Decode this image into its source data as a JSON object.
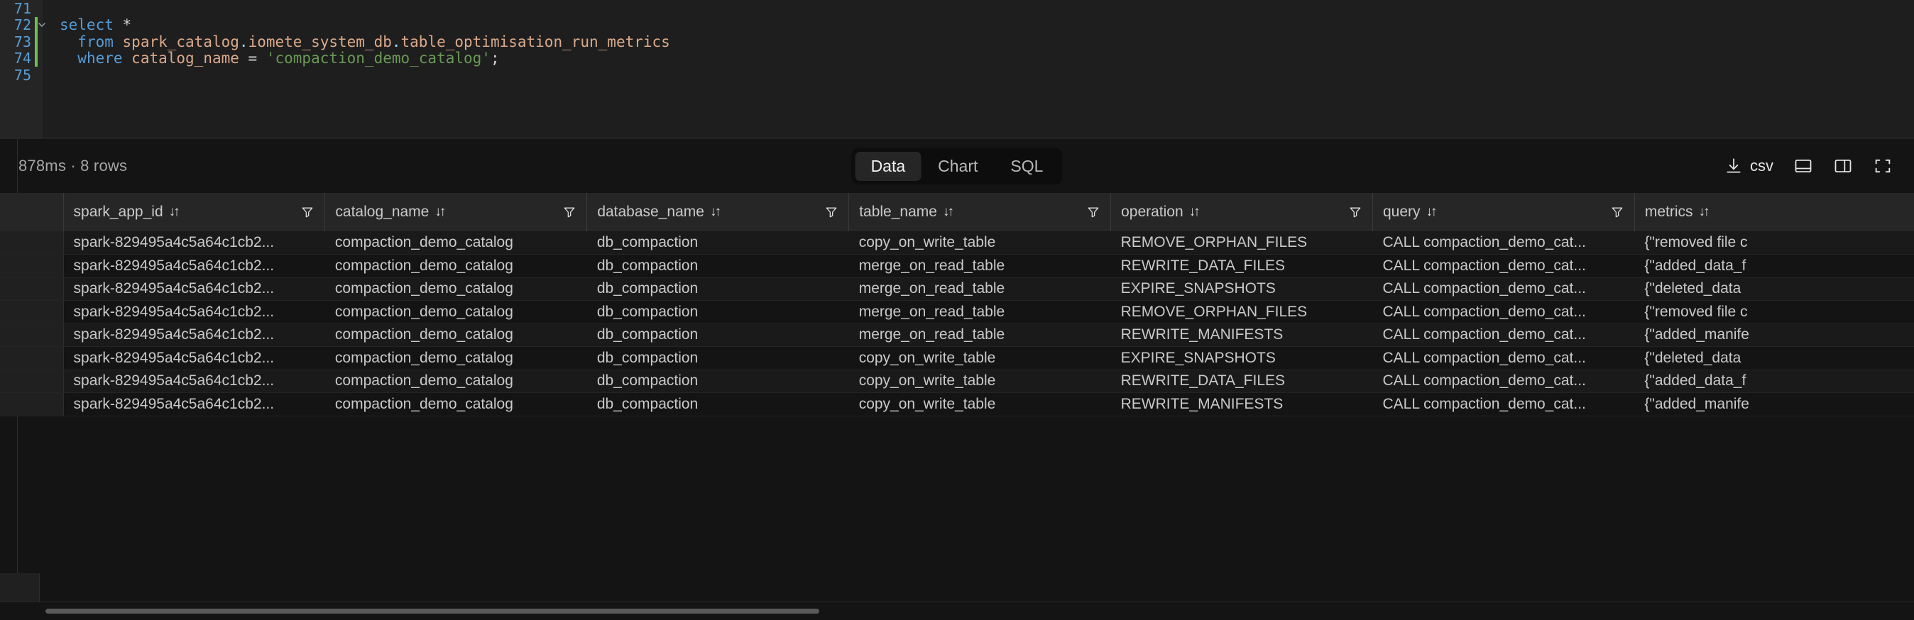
{
  "editor": {
    "lines": [
      {
        "number": "71",
        "active": false,
        "fold": "",
        "tokens": []
      },
      {
        "number": "72",
        "active": true,
        "fold": "chevron-down",
        "tokens": [
          {
            "t": "select",
            "c": "kw"
          },
          {
            "t": " ",
            "c": "op"
          },
          {
            "t": "*",
            "c": "star"
          }
        ]
      },
      {
        "number": "73",
        "active": true,
        "fold": "",
        "tokens": [
          {
            "t": "  ",
            "c": "op"
          },
          {
            "t": "from",
            "c": "kw"
          },
          {
            "t": " ",
            "c": "op"
          },
          {
            "t": "spark_catalog",
            "c": "ident"
          },
          {
            "t": ".",
            "c": "punct"
          },
          {
            "t": "iomete_system_db",
            "c": "ident"
          },
          {
            "t": ".",
            "c": "punct"
          },
          {
            "t": "table_optimisation_run_metrics",
            "c": "ident"
          }
        ]
      },
      {
        "number": "74",
        "active": true,
        "fold": "",
        "tokens": [
          {
            "t": "  ",
            "c": "op"
          },
          {
            "t": "where",
            "c": "kw"
          },
          {
            "t": " ",
            "c": "op"
          },
          {
            "t": "catalog_name",
            "c": "ident"
          },
          {
            "t": " ",
            "c": "op"
          },
          {
            "t": "=",
            "c": "op"
          },
          {
            "t": " ",
            "c": "op"
          },
          {
            "t": "'compaction_demo_catalog'",
            "c": "str"
          },
          {
            "t": ";",
            "c": "op"
          }
        ]
      },
      {
        "number": "75",
        "active": false,
        "fold": "",
        "tokens": []
      }
    ]
  },
  "results": {
    "status": "878ms · 8 rows",
    "tabs": [
      {
        "label": "Data",
        "active": true
      },
      {
        "label": "Chart",
        "active": false
      },
      {
        "label": "SQL",
        "active": false
      }
    ],
    "tools": [
      {
        "name": "download-csv",
        "label": "csv",
        "icon": "download-icon"
      },
      {
        "name": "split-horizontal",
        "label": "",
        "icon": "layout-horizontal-icon"
      },
      {
        "name": "split-vertical",
        "label": "",
        "icon": "layout-vertical-icon"
      },
      {
        "name": "fullscreen",
        "label": "",
        "icon": "fullscreen-icon"
      }
    ],
    "table": {
      "columns": [
        {
          "key": "spark_app_id",
          "label": "spark_app_id",
          "sortable": true,
          "filterable": true
        },
        {
          "key": "catalog_name",
          "label": "catalog_name",
          "sortable": true,
          "filterable": true
        },
        {
          "key": "database_name",
          "label": "database_name",
          "sortable": true,
          "filterable": true
        },
        {
          "key": "table_name",
          "label": "table_name",
          "sortable": true,
          "filterable": true
        },
        {
          "key": "operation",
          "label": "operation",
          "sortable": true,
          "filterable": true
        },
        {
          "key": "query",
          "label": "query",
          "sortable": true,
          "filterable": true
        },
        {
          "key": "metrics",
          "label": "metrics",
          "sortable": true,
          "filterable": false
        }
      ],
      "sort_glyph": "↓↑",
      "rows": [
        [
          "spark-829495a4c5a64c1cb2...",
          "compaction_demo_catalog",
          "db_compaction",
          "copy_on_write_table",
          "REMOVE_ORPHAN_FILES",
          "CALL compaction_demo_cat...",
          "{\"removed file c"
        ],
        [
          "spark-829495a4c5a64c1cb2...",
          "compaction_demo_catalog",
          "db_compaction",
          "merge_on_read_table",
          "REWRITE_DATA_FILES",
          "CALL compaction_demo_cat...",
          "{\"added_data_f"
        ],
        [
          "spark-829495a4c5a64c1cb2...",
          "compaction_demo_catalog",
          "db_compaction",
          "merge_on_read_table",
          "EXPIRE_SNAPSHOTS",
          "CALL compaction_demo_cat...",
          "{\"deleted_data"
        ],
        [
          "spark-829495a4c5a64c1cb2...",
          "compaction_demo_catalog",
          "db_compaction",
          "merge_on_read_table",
          "REMOVE_ORPHAN_FILES",
          "CALL compaction_demo_cat...",
          "{\"removed file c"
        ],
        [
          "spark-829495a4c5a64c1cb2...",
          "compaction_demo_catalog",
          "db_compaction",
          "merge_on_read_table",
          "REWRITE_MANIFESTS",
          "CALL compaction_demo_cat...",
          "{\"added_manife"
        ],
        [
          "spark-829495a4c5a64c1cb2...",
          "compaction_demo_catalog",
          "db_compaction",
          "copy_on_write_table",
          "EXPIRE_SNAPSHOTS",
          "CALL compaction_demo_cat...",
          "{\"deleted_data"
        ],
        [
          "spark-829495a4c5a64c1cb2...",
          "compaction_demo_catalog",
          "db_compaction",
          "copy_on_write_table",
          "REWRITE_DATA_FILES",
          "CALL compaction_demo_cat...",
          "{\"added_data_f"
        ],
        [
          "spark-829495a4c5a64c1cb2...",
          "compaction_demo_catalog",
          "db_compaction",
          "copy_on_write_table",
          "REWRITE_MANIFESTS",
          "CALL compaction_demo_cat...",
          "{\"added_manife"
        ]
      ]
    }
  },
  "colors": {
    "background": "#1e1e1e",
    "results_background": "#141414",
    "header_background": "#262626",
    "active_line_marker": "#6fbf4f",
    "keyword": "#569cd6",
    "identifier": "#dba98b",
    "string": "#6a9955",
    "line_number": "#5a9fd4"
  }
}
